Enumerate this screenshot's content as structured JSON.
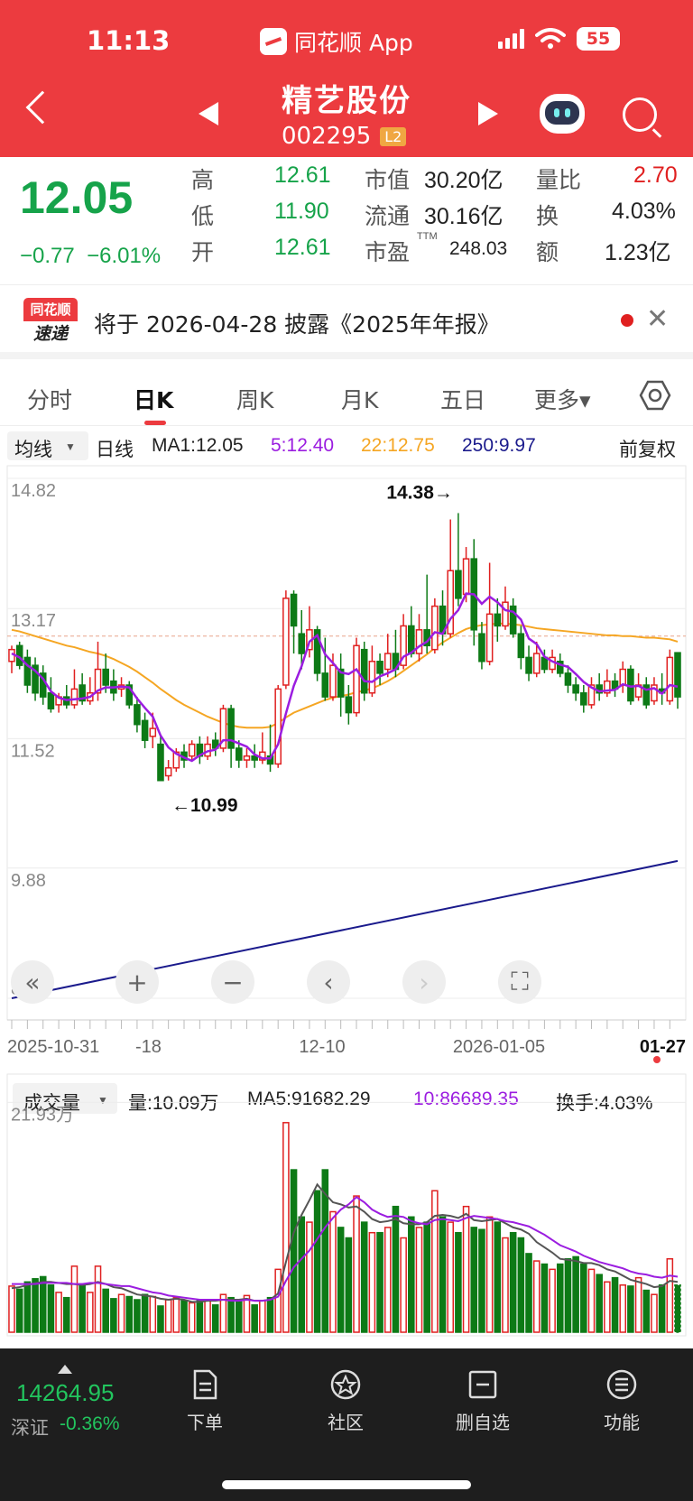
{
  "status_bar": {
    "time": "11:13",
    "app": "同花顺 App",
    "battery": "55"
  },
  "header": {
    "name": "精艺股份",
    "code": "002295",
    "badge": "L2"
  },
  "quote": {
    "price": "12.05",
    "change": "−0.77",
    "change_pct": "−6.01%",
    "high_label": "高",
    "high": "12.61",
    "low_label": "低",
    "low": "11.90",
    "open_label": "开",
    "open": "12.61",
    "mcap_label": "市值",
    "mcap": "30.20亿",
    "float_label": "流通",
    "float": "30.16亿",
    "pe_label": "市盈",
    "pe_sup": "TTM",
    "pe": "248.03",
    "vr_label": "量比",
    "vr": "2.70",
    "turnover_label": "换",
    "turnover": "4.03%",
    "amount_label": "额",
    "amount": "1.23亿"
  },
  "notice": {
    "logo_top": "同花顺",
    "logo_bottom": "速递",
    "text": "将于 2026-04-28 披露《2025年年报》"
  },
  "tabs": [
    "分时",
    "日K",
    "周K",
    "月K",
    "五日",
    "更多▾"
  ],
  "ma_legend": {
    "selector": "均线",
    "type": "日线",
    "ma1": "MA1:12.05",
    "ma5": "5:12.40",
    "ma22": "22:12.75",
    "ma250": "250:9.97",
    "adjust": "前复权"
  },
  "colors": {
    "up": "#e02020",
    "down": "#0d7a16",
    "ma5": "#9b1de0",
    "ma22": "#f5a623",
    "ma250": "#1a1a8c",
    "ma10vol": "#9b1de0",
    "ma5vol": "#555555"
  },
  "chart_data": [
    {
      "type": "candlestick",
      "y_ticks": [
        "14.82",
        "13.17",
        "11.52",
        "9.88",
        "8.23"
      ],
      "ylim": [
        8.23,
        14.82
      ],
      "x_ticks": [
        "2025-10-31",
        "-18",
        "12-10",
        "2026-01-05",
        "01-27"
      ],
      "annotations": {
        "high": "14.38→",
        "low": "←10.99"
      },
      "candles": [
        [
          12.5,
          12.65,
          12.35,
          12.7
        ],
        [
          12.7,
          12.45,
          12.4,
          12.75
        ],
        [
          12.55,
          12.2,
          12.1,
          12.65
        ],
        [
          12.45,
          12.1,
          12.0,
          12.55
        ],
        [
          12.35,
          12.05,
          11.95,
          12.45
        ],
        [
          12.1,
          11.9,
          11.85,
          12.3
        ],
        [
          11.95,
          12.05,
          11.85,
          12.1
        ],
        [
          12.05,
          11.95,
          11.9,
          12.2
        ],
        [
          11.95,
          12.15,
          11.9,
          12.4
        ],
        [
          12.2,
          12.0,
          11.95,
          12.35
        ],
        [
          12.0,
          12.1,
          11.95,
          12.3
        ],
        [
          12.1,
          12.4,
          12.0,
          12.75
        ],
        [
          12.4,
          12.2,
          12.1,
          12.6
        ],
        [
          12.25,
          12.1,
          12.0,
          12.4
        ],
        [
          12.15,
          12.2,
          12.05,
          12.3
        ],
        [
          12.2,
          11.95,
          11.9,
          12.25
        ],
        [
          11.95,
          11.7,
          11.6,
          12.05
        ],
        [
          11.75,
          11.5,
          11.4,
          11.85
        ],
        [
          11.55,
          11.65,
          11.4,
          11.85
        ],
        [
          11.45,
          10.99,
          10.99,
          11.55
        ],
        [
          11.05,
          11.15,
          10.99,
          11.25
        ],
        [
          11.15,
          11.35,
          11.1,
          11.4
        ],
        [
          11.35,
          11.25,
          11.15,
          11.45
        ],
        [
          11.3,
          11.45,
          11.25,
          11.5
        ],
        [
          11.45,
          11.3,
          11.2,
          11.55
        ],
        [
          11.3,
          11.45,
          11.25,
          11.55
        ],
        [
          11.5,
          11.4,
          11.3,
          11.6
        ],
        [
          11.4,
          11.9,
          11.35,
          11.95
        ],
        [
          11.9,
          11.4,
          11.15,
          11.95
        ],
        [
          11.4,
          11.25,
          11.15,
          11.5
        ],
        [
          11.25,
          11.3,
          11.15,
          11.4
        ],
        [
          11.3,
          11.25,
          11.15,
          11.45
        ],
        [
          11.25,
          11.35,
          11.2,
          11.6
        ],
        [
          11.3,
          11.2,
          11.1,
          11.7
        ],
        [
          11.2,
          12.15,
          11.15,
          12.2
        ],
        [
          12.2,
          13.3,
          12.15,
          13.4
        ],
        [
          13.35,
          12.95,
          12.6,
          13.4
        ],
        [
          12.85,
          12.6,
          12.4,
          13.15
        ],
        [
          12.65,
          12.9,
          12.55,
          13.2
        ],
        [
          12.9,
          12.35,
          12.25,
          12.95
        ],
        [
          12.35,
          12.05,
          12.0,
          12.8
        ],
        [
          12.05,
          12.45,
          12.0,
          12.6
        ],
        [
          12.4,
          12.05,
          11.8,
          12.6
        ],
        [
          12.05,
          11.85,
          11.7,
          12.2
        ],
        [
          11.85,
          12.7,
          11.8,
          12.8
        ],
        [
          12.65,
          12.1,
          12.0,
          12.75
        ],
        [
          12.1,
          12.5,
          12.05,
          12.7
        ],
        [
          12.5,
          12.35,
          12.2,
          12.6
        ],
        [
          12.4,
          12.6,
          12.3,
          12.85
        ],
        [
          12.6,
          12.4,
          12.3,
          12.9
        ],
        [
          12.45,
          12.95,
          12.4,
          13.1
        ],
        [
          12.95,
          12.6,
          12.55,
          13.2
        ],
        [
          12.6,
          12.9,
          12.5,
          13.1
        ],
        [
          12.9,
          12.7,
          12.6,
          13.6
        ],
        [
          12.65,
          13.2,
          12.6,
          13.3
        ],
        [
          13.2,
          12.85,
          12.7,
          13.4
        ],
        [
          12.85,
          13.65,
          12.8,
          14.3
        ],
        [
          13.65,
          13.3,
          13.2,
          14.38
        ],
        [
          13.35,
          13.8,
          13.25,
          13.95
        ],
        [
          13.8,
          12.9,
          12.7,
          14.05
        ],
        [
          12.85,
          12.5,
          12.4,
          13.0
        ],
        [
          12.5,
          13.1,
          12.45,
          13.75
        ],
        [
          13.1,
          12.95,
          12.75,
          13.3
        ],
        [
          12.95,
          13.25,
          12.9,
          13.45
        ],
        [
          13.2,
          12.85,
          12.8,
          13.3
        ],
        [
          12.85,
          12.55,
          12.4,
          12.95
        ],
        [
          12.55,
          12.35,
          12.25,
          12.7
        ],
        [
          12.35,
          12.6,
          12.3,
          12.75
        ],
        [
          12.55,
          12.4,
          12.35,
          12.65
        ],
        [
          12.4,
          12.55,
          12.35,
          12.65
        ],
        [
          12.5,
          12.35,
          12.3,
          12.6
        ],
        [
          12.35,
          12.2,
          12.1,
          12.45
        ],
        [
          12.2,
          12.1,
          12.0,
          12.3
        ],
        [
          12.1,
          11.95,
          11.85,
          12.2
        ],
        [
          11.95,
          12.2,
          11.9,
          12.3
        ],
        [
          12.2,
          12.1,
          12.0,
          12.35
        ],
        [
          12.1,
          12.25,
          12.05,
          12.4
        ],
        [
          12.25,
          12.15,
          12.05,
          12.35
        ],
        [
          12.2,
          12.4,
          12.1,
          12.5
        ],
        [
          12.4,
          12.0,
          11.95,
          12.45
        ],
        [
          12.05,
          12.2,
          12.0,
          12.35
        ],
        [
          12.2,
          11.95,
          11.9,
          12.3
        ],
        [
          12.0,
          12.2,
          11.95,
          12.3
        ],
        [
          12.15,
          12.1,
          11.95,
          12.35
        ],
        [
          12.0,
          12.55,
          11.95,
          12.65
        ],
        [
          12.61,
          12.05,
          11.9,
          12.61
        ]
      ],
      "ma5": [
        12.6,
        12.55,
        12.45,
        12.38,
        12.28,
        12.12,
        12.04,
        12.01,
        12.02,
        12.03,
        12.05,
        12.13,
        12.17,
        12.17,
        12.18,
        12.17,
        12.03,
        11.91,
        11.8,
        11.56,
        11.41,
        11.33,
        11.28,
        11.24,
        11.31,
        11.36,
        11.38,
        11.5,
        11.5,
        11.46,
        11.42,
        11.32,
        11.27,
        11.27,
        11.45,
        11.84,
        12.19,
        12.44,
        12.75,
        12.83,
        12.59,
        12.48,
        12.36,
        12.34,
        12.4,
        12.25,
        12.24,
        12.31,
        12.35,
        12.4,
        12.56,
        12.61,
        12.69,
        12.75,
        12.87,
        12.85,
        13.04,
        13.15,
        13.36,
        13.35,
        13.23,
        13.32,
        13.25,
        13.15,
        13.13,
        13.03,
        12.79,
        12.72,
        12.56,
        12.5,
        12.46,
        12.43,
        12.34,
        12.24,
        12.17,
        12.12,
        12.13,
        12.14,
        12.21,
        12.18,
        12.19,
        12.14,
        12.16,
        12.09,
        12.2,
        12.18
      ],
      "ma22": [
        12.9,
        12.88,
        12.85,
        12.82,
        12.79,
        12.76,
        12.73,
        12.7,
        12.68,
        12.65,
        12.62,
        12.6,
        12.57,
        12.53,
        12.48,
        12.43,
        12.37,
        12.3,
        12.23,
        12.15,
        12.08,
        12.01,
        11.95,
        11.9,
        11.85,
        11.8,
        11.76,
        11.72,
        11.69,
        11.67,
        11.66,
        11.66,
        11.66,
        11.67,
        11.72,
        11.79,
        11.85,
        11.89,
        11.93,
        11.97,
        12.01,
        12.04,
        12.06,
        12.08,
        12.11,
        12.13,
        12.16,
        12.2,
        12.25,
        12.31,
        12.38,
        12.45,
        12.52,
        12.59,
        12.67,
        12.74,
        12.8,
        12.86,
        12.91,
        12.94,
        12.96,
        12.97,
        12.98,
        12.98,
        12.97,
        12.96,
        12.94,
        12.92,
        12.91,
        12.9,
        12.89,
        12.88,
        12.87,
        12.86,
        12.85,
        12.84,
        12.83,
        12.83,
        12.82,
        12.82,
        12.81,
        12.8,
        12.8,
        12.79,
        12.78,
        12.75
      ],
      "ma250": {
        "start": 8.23,
        "end": 9.97
      }
    },
    {
      "type": "bar",
      "name": "成交量",
      "y_ticks": [
        "21.93万"
      ],
      "vol_label": "量:10.09万",
      "ma5_label": "MA5:91682.29",
      "ma10_label": "10:86689.35",
      "turnover_label": "换手:4.03%",
      "volumes": [
        4.4,
        4.1,
        4.8,
        5.1,
        5.3,
        4.5,
        3.8,
        3.3,
        6.3,
        4.6,
        3.8,
        6.3,
        4.1,
        3.2,
        3.6,
        3.4,
        3.1,
        3.6,
        3.4,
        2.5,
        3.1,
        3.3,
        3.0,
        2.8,
        3.0,
        3.1,
        2.6,
        3.6,
        3.3,
        2.9,
        3.5,
        2.6,
        3.0,
        3.3,
        6.0,
        20.0,
        15.5,
        11.0,
        10.5,
        13.5,
        15.5,
        11.5,
        10.0,
        9.0,
        13.0,
        10.5,
        9.5,
        9.5,
        10.0,
        12.0,
        9.0,
        11.0,
        10.0,
        10.5,
        13.5,
        11.0,
        10.5,
        9.5,
        12.0,
        10.0,
        9.8,
        11.0,
        10.5,
        9.0,
        9.5,
        9.0,
        7.5,
        6.8,
        6.5,
        6.0,
        6.5,
        7.0,
        7.2,
        6.5,
        6.0,
        5.5,
        4.8,
        5.2,
        4.5,
        4.4,
        5.2,
        4.0,
        3.6,
        4.5,
        7.0,
        4.5
      ],
      "ma5": [
        4.2,
        4.3,
        4.5,
        4.7,
        4.8,
        4.8,
        4.7,
        4.6,
        4.6,
        4.5,
        4.6,
        4.8,
        4.6,
        4.3,
        4.2,
        3.9,
        3.6,
        3.5,
        3.4,
        3.2,
        3.1,
        3.2,
        3.1,
        2.9,
        2.9,
        3.0,
        3.0,
        3.1,
        3.1,
        3.1,
        3.2,
        3.0,
        3.0,
        3.1,
        3.7,
        6.7,
        9.5,
        11.2,
        12.6,
        14.1,
        13.2,
        12.4,
        12.2,
        11.9,
        12.0,
        11.5,
        10.8,
        10.5,
        10.6,
        10.8,
        10.4,
        10.3,
        10.3,
        10.5,
        11.1,
        11.2,
        11.1,
        10.9,
        11.3,
        10.7,
        10.6,
        10.7,
        10.8,
        10.4,
        10.0,
        9.8,
        9.4,
        8.6,
        8.1,
        7.6,
        7.0,
        6.9,
        6.8,
        6.6,
        6.6,
        6.4,
        6.0,
        5.8,
        5.4,
        5.0,
        4.8,
        4.6,
        4.3,
        4.4,
        4.9,
        4.8
      ],
      "ma10": [
        4.6,
        4.6,
        4.6,
        4.6,
        4.7,
        4.7,
        4.7,
        4.7,
        4.6,
        4.6,
        4.7,
        4.7,
        4.6,
        4.5,
        4.4,
        4.4,
        4.2,
        4.0,
        3.8,
        3.7,
        3.5,
        3.4,
        3.3,
        3.2,
        3.1,
        3.1,
        3.1,
        3.1,
        3.0,
        3.0,
        3.1,
        3.0,
        3.0,
        3.1,
        3.4,
        4.9,
        6.2,
        7.0,
        7.8,
        8.9,
        10.0,
        10.9,
        11.7,
        12.2,
        12.9,
        12.4,
        11.7,
        11.3,
        11.0,
        11.1,
        11.0,
        10.6,
        10.4,
        10.3,
        10.7,
        10.8,
        10.7,
        10.6,
        10.9,
        11.1,
        11.0,
        10.9,
        10.8,
        10.6,
        10.5,
        10.3,
        10.1,
        9.7,
        9.3,
        8.8,
        8.3,
        8.0,
        7.7,
        7.3,
        7.0,
        6.7,
        6.5,
        6.3,
        6.1,
        5.8,
        5.6,
        5.5,
        5.3,
        5.2,
        5.4,
        5.3
      ]
    }
  ],
  "bottom_nav": {
    "index_value": "14264.95",
    "index_name": "深证",
    "index_change": "-0.36%",
    "items": [
      "下单",
      "社区",
      "删自选",
      "功能"
    ]
  }
}
